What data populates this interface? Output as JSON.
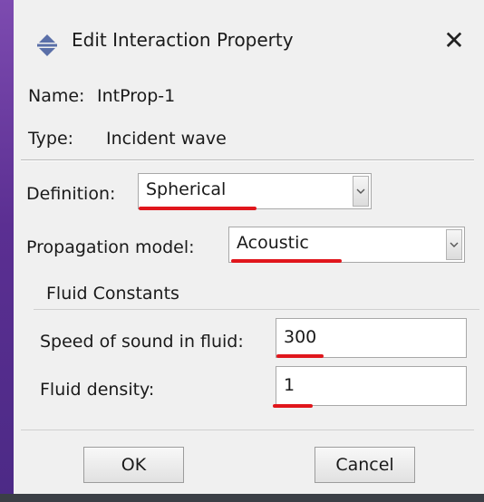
{
  "window": {
    "title": "Edit Interaction Property",
    "close_symbol": "✕",
    "title_icon": "interaction-property-icon"
  },
  "info": {
    "name_label": "Name:",
    "name_value": "IntProp-1",
    "type_label": "Type:",
    "type_value": "Incident wave"
  },
  "definition": {
    "label": "Definition:",
    "selected": "Spherical"
  },
  "propagation": {
    "label": "Propagation model:",
    "selected": "Acoustic"
  },
  "fluid_constants": {
    "heading": "Fluid Constants",
    "speed_label": "Speed of sound in fluid:",
    "speed_value": "300",
    "density_label": "Fluid density:",
    "density_value": "1"
  },
  "buttons": {
    "ok_label": "OK",
    "cancel_label": "Cancel"
  },
  "colors": {
    "annotation_underline": "#e0161c",
    "window_background": "#f0f0f0",
    "left_strip": "#5b2f92"
  }
}
